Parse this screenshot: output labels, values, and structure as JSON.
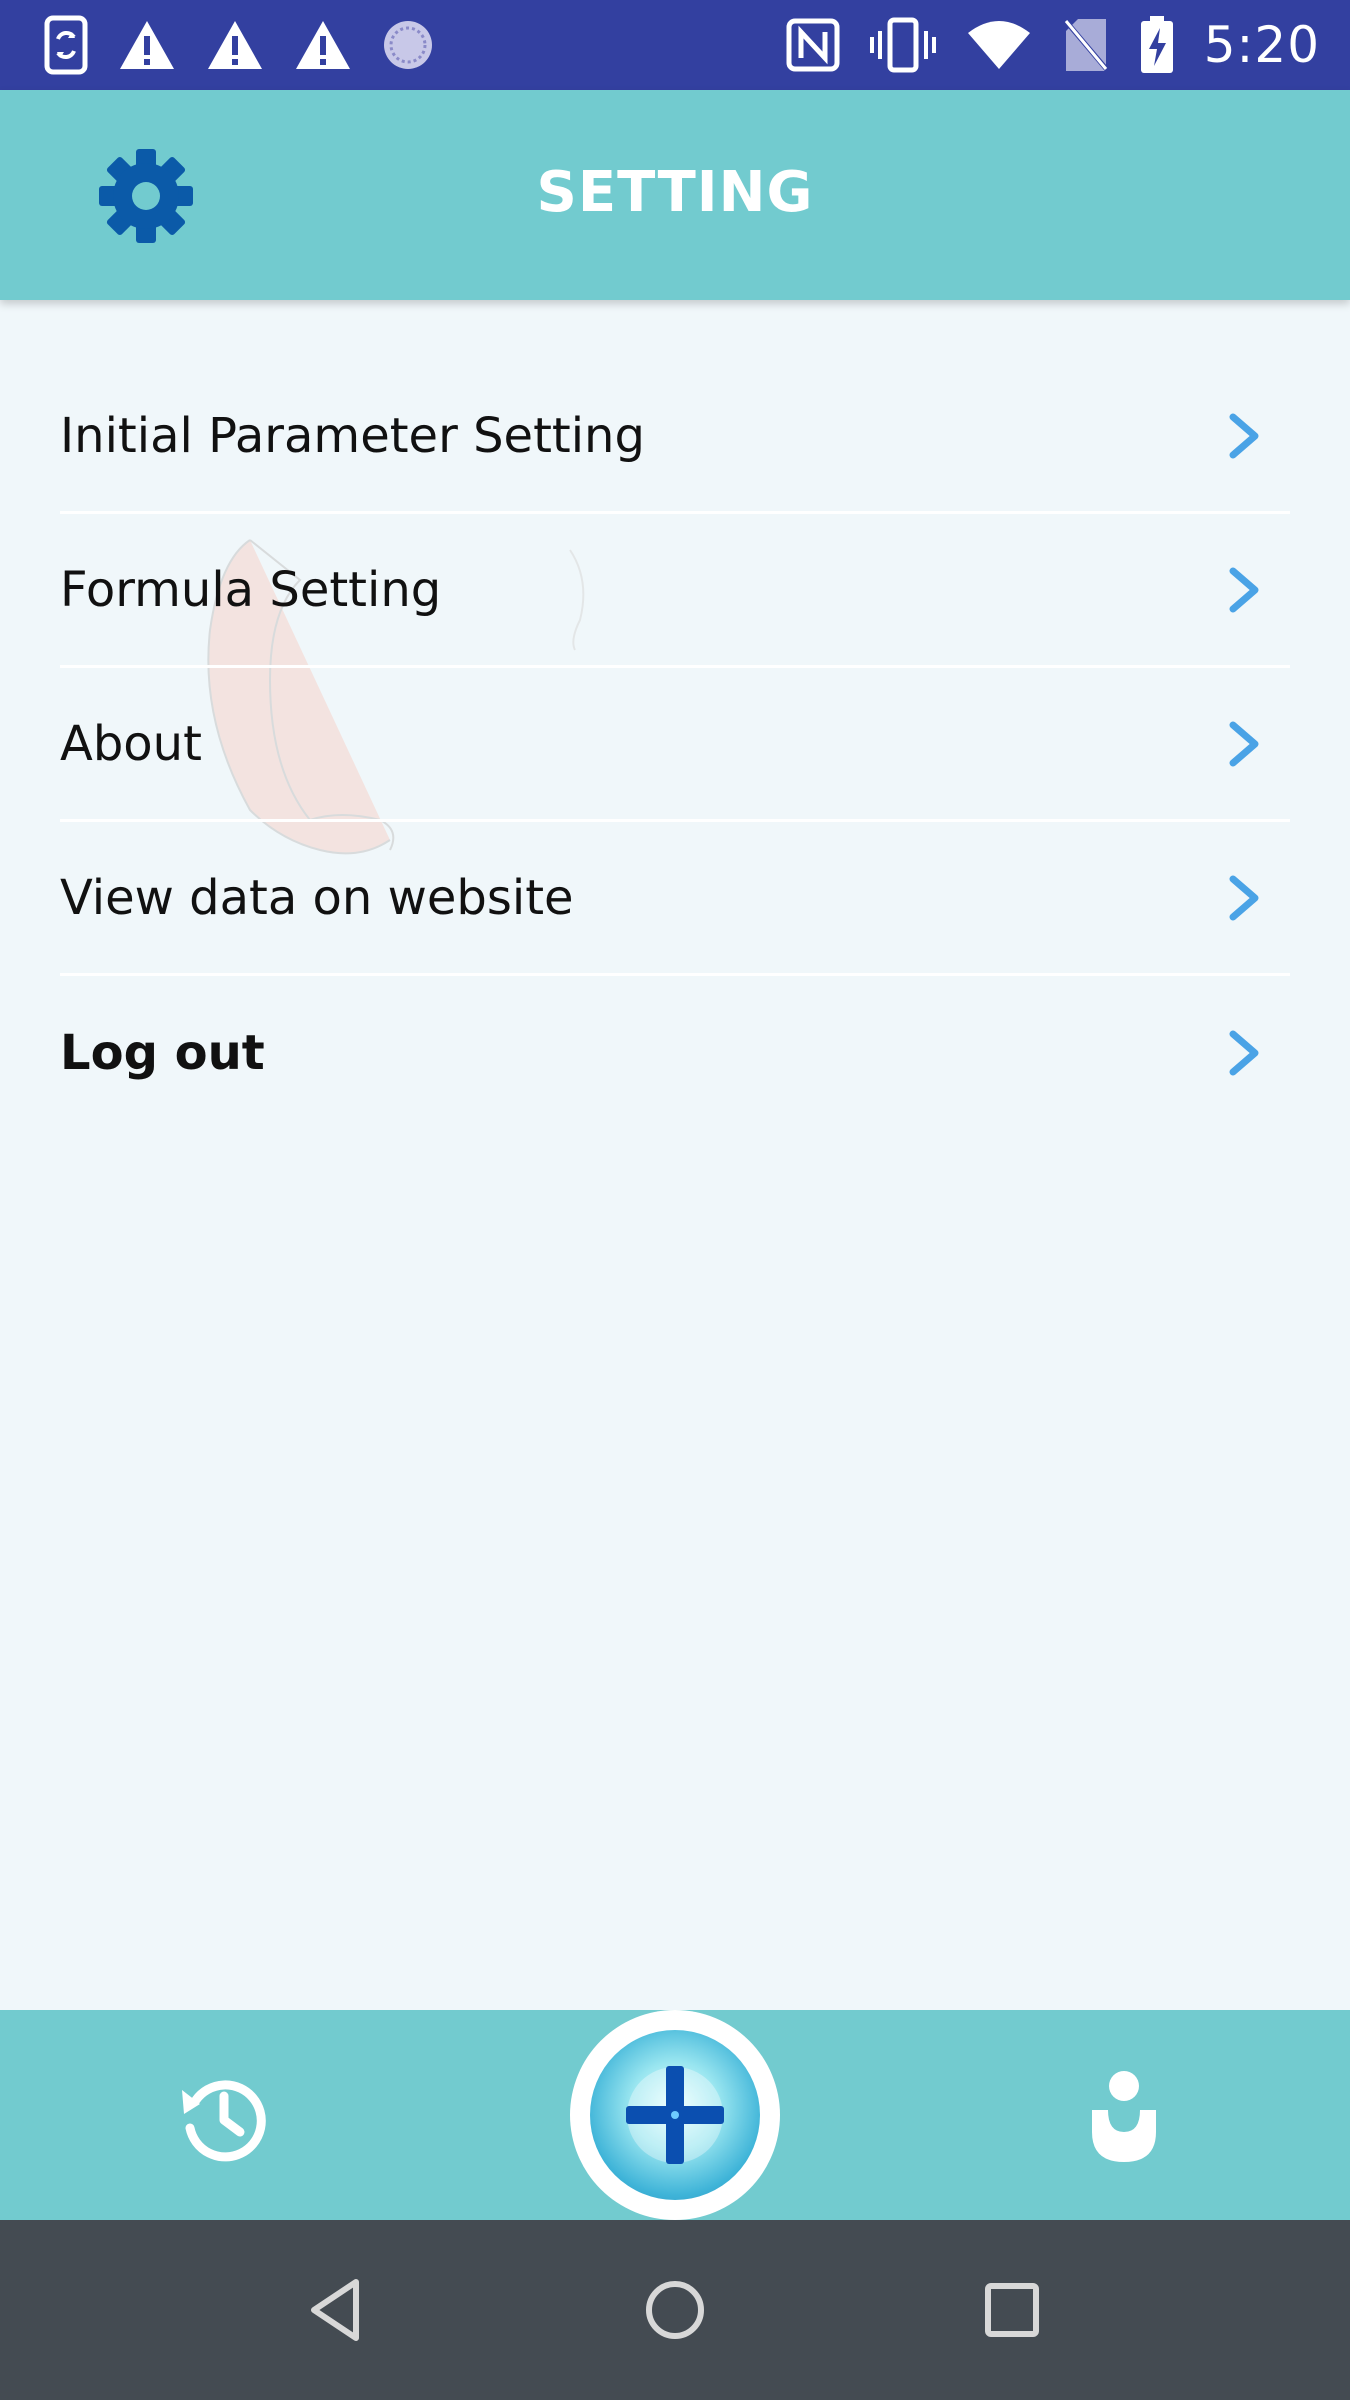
{
  "status_bar": {
    "time": "5:20",
    "icons_left": [
      "phone-sync-icon",
      "warning-icon",
      "warning-icon",
      "warning-icon",
      "loading-icon"
    ],
    "icons_right": [
      "nfc-icon",
      "vibrate-icon",
      "wifi-icon",
      "no-sim-icon",
      "battery-charging-icon"
    ]
  },
  "header": {
    "title": "SETTING",
    "icon": "gear-icon"
  },
  "menu": {
    "items": [
      {
        "label": "Initial Parameter Setting",
        "bold": false
      },
      {
        "label": "Formula Setting",
        "bold": false
      },
      {
        "label": "About",
        "bold": false
      },
      {
        "label": "View data on website",
        "bold": false
      },
      {
        "label": "Log out",
        "bold": true
      }
    ]
  },
  "bottom_nav": {
    "items": [
      "history-icon",
      "add-measurement-icon",
      "profile-icon"
    ]
  },
  "system_nav": {
    "items": [
      "back-icon",
      "home-icon",
      "recents-icon"
    ]
  },
  "colors": {
    "status_bar": "#3340a0",
    "header": "#72cbcf",
    "background": "#f0f7fa",
    "gear": "#0b5aa8",
    "chevron": "#4aa3e6",
    "system_nav": "#444b52"
  }
}
